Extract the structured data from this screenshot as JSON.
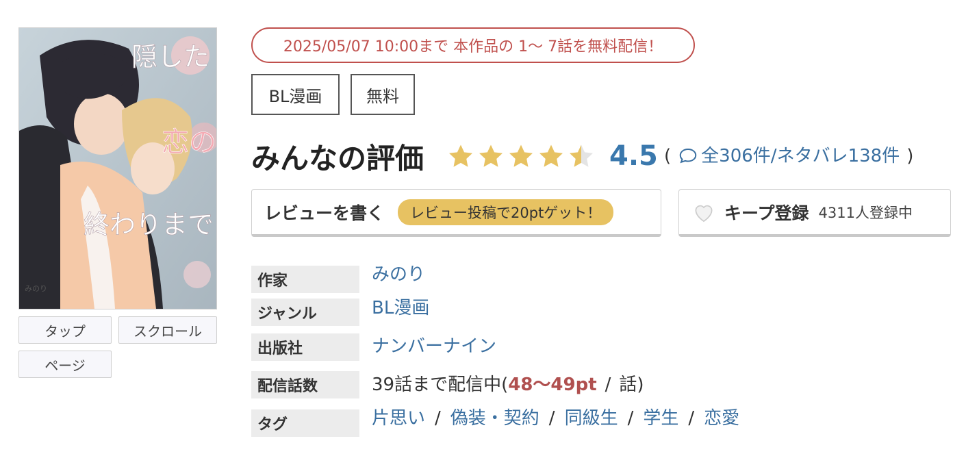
{
  "cover": {
    "title_lines": [
      "隠した",
      "恋の",
      "終わりまで"
    ],
    "author_mark": "みのり"
  },
  "view_buttons": [
    "タップ",
    "スクロール",
    "ページ"
  ],
  "promo": "2025/05/07 10:00まで 本作品の 1〜 7話を無料配信！",
  "tags_top": [
    "BL漫画",
    "無料"
  ],
  "rating": {
    "label": "みんなの評価",
    "stars": 4.5,
    "score": "4.5",
    "open_paren": "(",
    "total": "全306件",
    "slash": "/",
    "spoilers": "ネタバレ138件",
    "close_paren": ")"
  },
  "review": {
    "label": "レビューを書く",
    "badge": "レビュー投稿で20ptゲット！"
  },
  "keep": {
    "label": "キープ登録",
    "count": "4311人登録中"
  },
  "info": {
    "author_label": "作家",
    "author": "みのり",
    "genre_label": "ジャンル",
    "genre": "BL漫画",
    "publisher_label": "出版社",
    "publisher": "ナンバーナイン",
    "episodes_label": "配信話数",
    "episodes_prefix": "39話まで配信中(",
    "episodes_price": "48〜49pt",
    "episodes_suffix_slash": "/",
    "episodes_suffix": "話)",
    "tags_label": "タグ",
    "tags": [
      "片思い",
      "偽装・契約",
      "同級生",
      "学生",
      "恋愛"
    ],
    "tag_sep": "/"
  },
  "colors": {
    "promo": "#c0504d",
    "link": "#3a6fa0",
    "score": "#3a78ad",
    "star": "#e7c262",
    "badge": "#e7c262",
    "price": "#b0504f"
  }
}
